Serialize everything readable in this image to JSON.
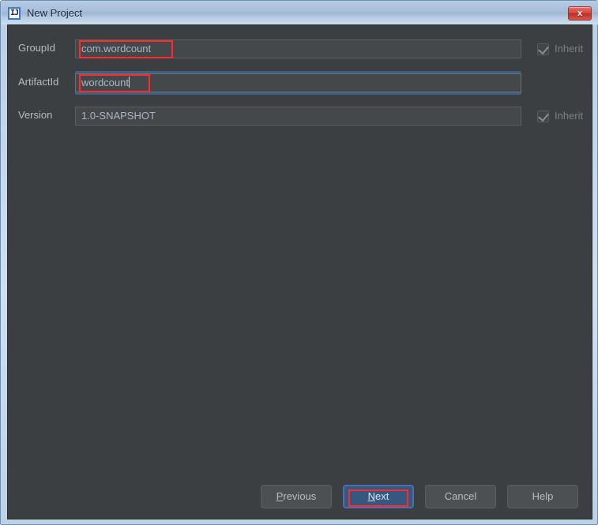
{
  "window": {
    "title": "New Project",
    "icon": "intellij-idea-icon",
    "close_label": "x",
    "frame_color": "#c2d6ea",
    "titlebar_text_color": "#10243c",
    "dialog_background": "#3c3f41"
  },
  "form": {
    "rows": [
      {
        "label": "GroupId",
        "value": "com.wordcount",
        "placeholder": "GroupId",
        "focused": false,
        "annotated": true,
        "annotation_color": "#ff2a2a",
        "inherit": {
          "visible": true,
          "label": "Inherit",
          "checked": true,
          "enabled": false
        }
      },
      {
        "label": "ArtifactId",
        "value": "wordcount",
        "placeholder": "ArtifactId",
        "focused": true,
        "annotated": true,
        "annotation_color": "#ff2a2a",
        "caret": true,
        "inherit": {
          "visible": false,
          "label": "",
          "checked": false,
          "enabled": false
        }
      },
      {
        "label": "Version",
        "value": "1.0-SNAPSHOT",
        "placeholder": "Version",
        "focused": false,
        "annotated": false,
        "inherit": {
          "visible": true,
          "label": "Inherit",
          "checked": true,
          "enabled": false
        }
      }
    ]
  },
  "buttons": {
    "previous": {
      "label_pre": "",
      "mnemonic": "P",
      "label_post": "revious",
      "default": false,
      "annotated": false
    },
    "next": {
      "label_pre": "",
      "mnemonic": "N",
      "label_post": "ext",
      "default": true,
      "annotated": true,
      "annotation_color": "#ff2a2a",
      "accent": "#365880"
    },
    "cancel": {
      "label": "Cancel",
      "default": false,
      "annotated": false
    },
    "help": {
      "label": "Help",
      "default": false,
      "annotated": false
    }
  }
}
